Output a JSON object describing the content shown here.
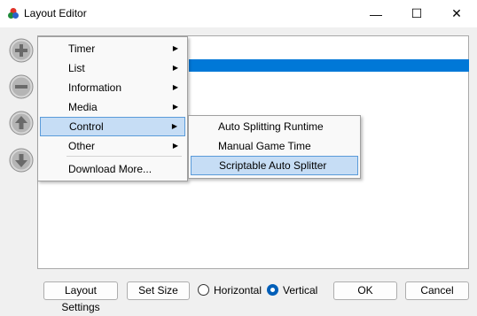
{
  "window": {
    "title": "Layout Editor",
    "controls": {
      "minimize": "—",
      "maximize": "☐",
      "close": "✕"
    }
  },
  "side_buttons": [
    "add-icon",
    "remove-icon",
    "move-up-icon",
    "move-down-icon"
  ],
  "context_menu": {
    "items": [
      {
        "label": "Timer",
        "has_submenu": true
      },
      {
        "label": "List",
        "has_submenu": true
      },
      {
        "label": "Information",
        "has_submenu": true
      },
      {
        "label": "Media",
        "has_submenu": true
      },
      {
        "label": "Control",
        "has_submenu": true,
        "highlighted": true
      },
      {
        "label": "Other",
        "has_submenu": true
      },
      {
        "label": "Download More...",
        "has_submenu": false
      }
    ],
    "arrow": "▶"
  },
  "submenu": {
    "items": [
      {
        "label": "Auto Splitting Runtime"
      },
      {
        "label": "Manual Game Time"
      },
      {
        "label": "Scriptable Auto Splitter",
        "highlighted": true
      }
    ]
  },
  "footer": {
    "layout_settings": "Layout Settings",
    "set_size": "Set Size",
    "orientation": {
      "horizontal": "Horizontal",
      "vertical": "Vertical",
      "selected": "Vertical"
    },
    "ok": "OK",
    "cancel": "Cancel"
  },
  "colors": {
    "selection": "#0078d7",
    "menu_highlight": "#c6ddf5"
  }
}
